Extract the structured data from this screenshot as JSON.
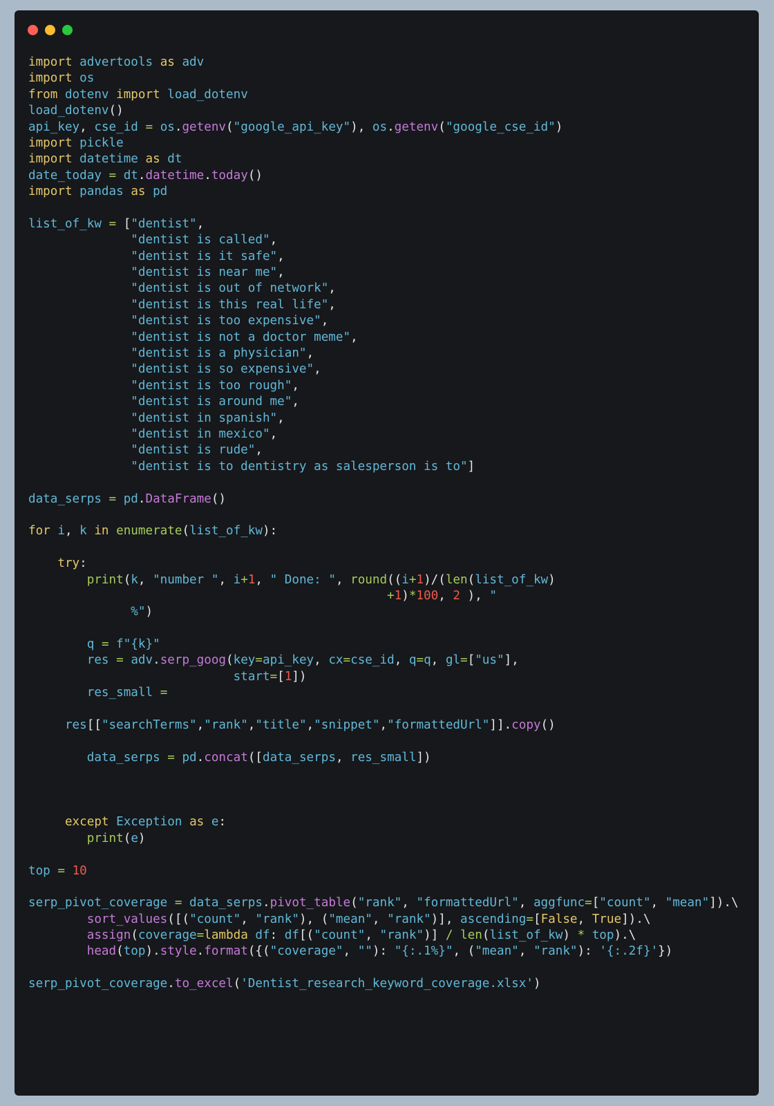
{
  "window": {
    "colors": {
      "background": "#16181b",
      "page_background": "#abbac8",
      "close_dot": "#fe5f57",
      "minimize_dot": "#febc2e",
      "maximize_dot": "#28c840"
    }
  },
  "syntax_colors": {
    "keyword": "#e6c86a",
    "identifier": "#62b8d8",
    "method": "#c67ad9",
    "builtin": "#a8cc5c",
    "string": "#62b8d8",
    "number": "#ef5a4a",
    "operator": "#a8cc5c",
    "punctuation": "#e6e6e6"
  },
  "code_lines": [
    [
      [
        "kw",
        "import"
      ],
      [
        "p",
        " "
      ],
      [
        "id",
        "advertools"
      ],
      [
        "p",
        " "
      ],
      [
        "kw",
        "as"
      ],
      [
        "p",
        " "
      ],
      [
        "id",
        "adv"
      ]
    ],
    [
      [
        "kw",
        "import"
      ],
      [
        "p",
        " "
      ],
      [
        "id",
        "os"
      ]
    ],
    [
      [
        "kw",
        "from"
      ],
      [
        "p",
        " "
      ],
      [
        "id",
        "dotenv"
      ],
      [
        "p",
        " "
      ],
      [
        "kw",
        "import"
      ],
      [
        "p",
        " "
      ],
      [
        "id",
        "load_dotenv"
      ]
    ],
    [
      [
        "id",
        "load_dotenv"
      ],
      [
        "p",
        "()"
      ]
    ],
    [
      [
        "id",
        "api_key"
      ],
      [
        "p",
        ", "
      ],
      [
        "id",
        "cse_id"
      ],
      [
        "p",
        " "
      ],
      [
        "op",
        "="
      ],
      [
        "p",
        " "
      ],
      [
        "id",
        "os"
      ],
      [
        "p",
        "."
      ],
      [
        "fn",
        "getenv"
      ],
      [
        "p",
        "("
      ],
      [
        "str",
        "\"google_api_key\""
      ],
      [
        "p",
        "), "
      ],
      [
        "id",
        "os"
      ],
      [
        "p",
        "."
      ],
      [
        "fn",
        "getenv"
      ],
      [
        "p",
        "("
      ],
      [
        "str",
        "\"google_cse_id\""
      ],
      [
        "p",
        ")"
      ]
    ],
    [
      [
        "kw",
        "import"
      ],
      [
        "p",
        " "
      ],
      [
        "id",
        "pickle"
      ]
    ],
    [
      [
        "kw",
        "import"
      ],
      [
        "p",
        " "
      ],
      [
        "id",
        "datetime"
      ],
      [
        "p",
        " "
      ],
      [
        "kw",
        "as"
      ],
      [
        "p",
        " "
      ],
      [
        "id",
        "dt"
      ]
    ],
    [
      [
        "id",
        "date_today"
      ],
      [
        "p",
        " "
      ],
      [
        "op",
        "="
      ],
      [
        "p",
        " "
      ],
      [
        "id",
        "dt"
      ],
      [
        "p",
        "."
      ],
      [
        "fn",
        "datetime"
      ],
      [
        "p",
        "."
      ],
      [
        "fn",
        "today"
      ],
      [
        "p",
        "()"
      ]
    ],
    [
      [
        "kw",
        "import"
      ],
      [
        "p",
        " "
      ],
      [
        "id",
        "pandas"
      ],
      [
        "p",
        " "
      ],
      [
        "kw",
        "as"
      ],
      [
        "p",
        " "
      ],
      [
        "id",
        "pd"
      ]
    ],
    [],
    [
      [
        "id",
        "list_of_kw"
      ],
      [
        "p",
        " "
      ],
      [
        "op",
        "="
      ],
      [
        "p",
        " ["
      ],
      [
        "str",
        "\"dentist\""
      ],
      [
        "p",
        ","
      ]
    ],
    [
      [
        "p",
        "              "
      ],
      [
        "str",
        "\"dentist is called\""
      ],
      [
        "p",
        ","
      ]
    ],
    [
      [
        "p",
        "              "
      ],
      [
        "str",
        "\"dentist is it safe\""
      ],
      [
        "p",
        ","
      ]
    ],
    [
      [
        "p",
        "              "
      ],
      [
        "str",
        "\"dentist is near me\""
      ],
      [
        "p",
        ","
      ]
    ],
    [
      [
        "p",
        "              "
      ],
      [
        "str",
        "\"dentist is out of network\""
      ],
      [
        "p",
        ","
      ]
    ],
    [
      [
        "p",
        "              "
      ],
      [
        "str",
        "\"dentist is this real life\""
      ],
      [
        "p",
        ","
      ]
    ],
    [
      [
        "p",
        "              "
      ],
      [
        "str",
        "\"dentist is too expensive\""
      ],
      [
        "p",
        ","
      ]
    ],
    [
      [
        "p",
        "              "
      ],
      [
        "str",
        "\"dentist is not a doctor meme\""
      ],
      [
        "p",
        ","
      ]
    ],
    [
      [
        "p",
        "              "
      ],
      [
        "str",
        "\"dentist is a physician\""
      ],
      [
        "p",
        ","
      ]
    ],
    [
      [
        "p",
        "              "
      ],
      [
        "str",
        "\"dentist is so expensive\""
      ],
      [
        "p",
        ","
      ]
    ],
    [
      [
        "p",
        "              "
      ],
      [
        "str",
        "\"dentist is too rough\""
      ],
      [
        "p",
        ","
      ]
    ],
    [
      [
        "p",
        "              "
      ],
      [
        "str",
        "\"dentist is around me\""
      ],
      [
        "p",
        ","
      ]
    ],
    [
      [
        "p",
        "              "
      ],
      [
        "str",
        "\"dentist in spanish\""
      ],
      [
        "p",
        ","
      ]
    ],
    [
      [
        "p",
        "              "
      ],
      [
        "str",
        "\"dentist in mexico\""
      ],
      [
        "p",
        ","
      ]
    ],
    [
      [
        "p",
        "              "
      ],
      [
        "str",
        "\"dentist is rude\""
      ],
      [
        "p",
        ","
      ]
    ],
    [
      [
        "p",
        "              "
      ],
      [
        "str",
        "\"dentist is to dentistry as salesperson is to\""
      ],
      [
        "p",
        "]"
      ]
    ],
    [],
    [
      [
        "id",
        "data_serps"
      ],
      [
        "p",
        " "
      ],
      [
        "op",
        "="
      ],
      [
        "p",
        " "
      ],
      [
        "id",
        "pd"
      ],
      [
        "p",
        "."
      ],
      [
        "fn",
        "DataFrame"
      ],
      [
        "p",
        "()"
      ]
    ],
    [],
    [
      [
        "kw",
        "for"
      ],
      [
        "p",
        " "
      ],
      [
        "id",
        "i"
      ],
      [
        "p",
        ", "
      ],
      [
        "id",
        "k"
      ],
      [
        "p",
        " "
      ],
      [
        "kw",
        "in"
      ],
      [
        "p",
        " "
      ],
      [
        "bi",
        "enumerate"
      ],
      [
        "p",
        "("
      ],
      [
        "id",
        "list_of_kw"
      ],
      [
        "p",
        "):"
      ]
    ],
    [],
    [
      [
        "p",
        "    "
      ],
      [
        "kw",
        "try"
      ],
      [
        "p",
        ":"
      ]
    ],
    [
      [
        "p",
        "        "
      ],
      [
        "bi",
        "print"
      ],
      [
        "p",
        "("
      ],
      [
        "id",
        "k"
      ],
      [
        "p",
        ", "
      ],
      [
        "str",
        "\"number \""
      ],
      [
        "p",
        ", "
      ],
      [
        "id",
        "i"
      ],
      [
        "op",
        "+"
      ],
      [
        "num",
        "1"
      ],
      [
        "p",
        ", "
      ],
      [
        "str",
        "\" Done: \""
      ],
      [
        "p",
        ", "
      ],
      [
        "bi",
        "round"
      ],
      [
        "p",
        "(("
      ],
      [
        "id",
        "i"
      ],
      [
        "op",
        "+"
      ],
      [
        "num",
        "1"
      ],
      [
        "p",
        ")/("
      ],
      [
        "bi",
        "len"
      ],
      [
        "p",
        "("
      ],
      [
        "id",
        "list_of_kw"
      ],
      [
        "p",
        ")"
      ]
    ],
    [
      [
        "p",
        "                                                 "
      ],
      [
        "op",
        "+"
      ],
      [
        "num",
        "1"
      ],
      [
        "p",
        ")"
      ],
      [
        "op",
        "*"
      ],
      [
        "num",
        "100"
      ],
      [
        "p",
        ", "
      ],
      [
        "num",
        "2"
      ],
      [
        "p",
        " ), "
      ],
      [
        "str",
        "\""
      ]
    ],
    [
      [
        "p",
        "              "
      ],
      [
        "str",
        "%\""
      ],
      [
        "p",
        ")"
      ]
    ],
    [],
    [
      [
        "p",
        "        "
      ],
      [
        "id",
        "q"
      ],
      [
        "p",
        " "
      ],
      [
        "op",
        "="
      ],
      [
        "p",
        " "
      ],
      [
        "id",
        "f"
      ],
      [
        "str",
        "\"{"
      ],
      [
        "id",
        "k"
      ],
      [
        "str",
        "}\""
      ]
    ],
    [
      [
        "p",
        "        "
      ],
      [
        "id",
        "res"
      ],
      [
        "p",
        " "
      ],
      [
        "op",
        "="
      ],
      [
        "p",
        " "
      ],
      [
        "id",
        "adv"
      ],
      [
        "p",
        "."
      ],
      [
        "fn",
        "serp_goog"
      ],
      [
        "p",
        "("
      ],
      [
        "id",
        "key"
      ],
      [
        "op",
        "="
      ],
      [
        "id",
        "api_key"
      ],
      [
        "p",
        ", "
      ],
      [
        "id",
        "cx"
      ],
      [
        "op",
        "="
      ],
      [
        "id",
        "cse_id"
      ],
      [
        "p",
        ", "
      ],
      [
        "id",
        "q"
      ],
      [
        "op",
        "="
      ],
      [
        "id",
        "q"
      ],
      [
        "p",
        ", "
      ],
      [
        "id",
        "gl"
      ],
      [
        "op",
        "="
      ],
      [
        "p",
        "["
      ],
      [
        "str",
        "\"us\""
      ],
      [
        "p",
        "],"
      ]
    ],
    [
      [
        "p",
        "                            "
      ],
      [
        "id",
        "start"
      ],
      [
        "op",
        "="
      ],
      [
        "p",
        "["
      ],
      [
        "num",
        "1"
      ],
      [
        "p",
        "])"
      ]
    ],
    [
      [
        "p",
        "        "
      ],
      [
        "id",
        "res_small"
      ],
      [
        "p",
        " "
      ],
      [
        "op",
        "="
      ]
    ],
    [],
    [
      [
        "p",
        "     "
      ],
      [
        "id",
        "res"
      ],
      [
        "p",
        "[["
      ],
      [
        "str",
        "\"searchTerms\""
      ],
      [
        "p",
        ","
      ],
      [
        "str",
        "\"rank\""
      ],
      [
        "p",
        ","
      ],
      [
        "str",
        "\"title\""
      ],
      [
        "p",
        ","
      ],
      [
        "str",
        "\"snippet\""
      ],
      [
        "p",
        ","
      ],
      [
        "str",
        "\"formattedUrl\""
      ],
      [
        "p",
        "]]."
      ],
      [
        "fn",
        "copy"
      ],
      [
        "p",
        "()"
      ]
    ],
    [],
    [
      [
        "p",
        "        "
      ],
      [
        "id",
        "data_serps"
      ],
      [
        "p",
        " "
      ],
      [
        "op",
        "="
      ],
      [
        "p",
        " "
      ],
      [
        "id",
        "pd"
      ],
      [
        "p",
        "."
      ],
      [
        "fn",
        "concat"
      ],
      [
        "p",
        "(["
      ],
      [
        "id",
        "data_serps"
      ],
      [
        "p",
        ", "
      ],
      [
        "id",
        "res_small"
      ],
      [
        "p",
        "])"
      ]
    ],
    [],
    [],
    [],
    [
      [
        "p",
        "     "
      ],
      [
        "kw",
        "except"
      ],
      [
        "p",
        " "
      ],
      [
        "id",
        "Exception"
      ],
      [
        "p",
        " "
      ],
      [
        "kw",
        "as"
      ],
      [
        "p",
        " "
      ],
      [
        "id",
        "e"
      ],
      [
        "p",
        ":"
      ]
    ],
    [
      [
        "p",
        "        "
      ],
      [
        "bi",
        "print"
      ],
      [
        "p",
        "("
      ],
      [
        "id",
        "e"
      ],
      [
        "p",
        ")"
      ]
    ],
    [],
    [
      [
        "id",
        "top"
      ],
      [
        "p",
        " "
      ],
      [
        "op",
        "="
      ],
      [
        "p",
        " "
      ],
      [
        "num",
        "10"
      ]
    ],
    [],
    [
      [
        "id",
        "serp_pivot_coverage"
      ],
      [
        "p",
        " "
      ],
      [
        "op",
        "="
      ],
      [
        "p",
        " "
      ],
      [
        "id",
        "data_serps"
      ],
      [
        "p",
        "."
      ],
      [
        "fn",
        "pivot_table"
      ],
      [
        "p",
        "("
      ],
      [
        "str",
        "\"rank\""
      ],
      [
        "p",
        ", "
      ],
      [
        "str",
        "\"formattedUrl\""
      ],
      [
        "p",
        ", "
      ],
      [
        "id",
        "aggfunc"
      ],
      [
        "op",
        "="
      ],
      [
        "p",
        "["
      ],
      [
        "str",
        "\"count\""
      ],
      [
        "p",
        ", "
      ],
      [
        "str",
        "\"mean\""
      ],
      [
        "p",
        "]).\\"
      ]
    ],
    [
      [
        "p",
        "        "
      ],
      [
        "fn",
        "sort_values"
      ],
      [
        "p",
        "([("
      ],
      [
        "str",
        "\"count\""
      ],
      [
        "p",
        ", "
      ],
      [
        "str",
        "\"rank\""
      ],
      [
        "p",
        "), ("
      ],
      [
        "str",
        "\"mean\""
      ],
      [
        "p",
        ", "
      ],
      [
        "str",
        "\"rank\""
      ],
      [
        "p",
        ")], "
      ],
      [
        "id",
        "ascending"
      ],
      [
        "op",
        "="
      ],
      [
        "p",
        "["
      ],
      [
        "bool",
        "False"
      ],
      [
        "p",
        ", "
      ],
      [
        "bool",
        "True"
      ],
      [
        "p",
        "]).\\"
      ]
    ],
    [
      [
        "p",
        "        "
      ],
      [
        "fn",
        "assign"
      ],
      [
        "p",
        "("
      ],
      [
        "id",
        "coverage"
      ],
      [
        "op",
        "="
      ],
      [
        "kw",
        "lambda"
      ],
      [
        "p",
        " "
      ],
      [
        "id",
        "df"
      ],
      [
        "p",
        ": "
      ],
      [
        "id",
        "df"
      ],
      [
        "p",
        "[("
      ],
      [
        "str",
        "\"count\""
      ],
      [
        "p",
        ", "
      ],
      [
        "str",
        "\"rank\""
      ],
      [
        "p",
        ")] "
      ],
      [
        "op",
        "/"
      ],
      [
        "p",
        " "
      ],
      [
        "bi",
        "len"
      ],
      [
        "p",
        "("
      ],
      [
        "id",
        "list_of_kw"
      ],
      [
        "p",
        ") "
      ],
      [
        "op",
        "*"
      ],
      [
        "p",
        " "
      ],
      [
        "id",
        "top"
      ],
      [
        "p",
        ").\\"
      ]
    ],
    [
      [
        "p",
        "        "
      ],
      [
        "fn",
        "head"
      ],
      [
        "p",
        "("
      ],
      [
        "id",
        "top"
      ],
      [
        "p",
        ")."
      ],
      [
        "fn",
        "style"
      ],
      [
        "p",
        "."
      ],
      [
        "fn",
        "format"
      ],
      [
        "p",
        "({("
      ],
      [
        "str",
        "\"coverage\""
      ],
      [
        "p",
        ", "
      ],
      [
        "str",
        "\"\""
      ],
      [
        "p",
        "): "
      ],
      [
        "str",
        "\"{:.1%}\""
      ],
      [
        "p",
        ", ("
      ],
      [
        "str",
        "\"mean\""
      ],
      [
        "p",
        ", "
      ],
      [
        "str",
        "\"rank\""
      ],
      [
        "p",
        "): "
      ],
      [
        "str",
        "'{:.2f}'"
      ],
      [
        "p",
        "})"
      ]
    ],
    [],
    [
      [
        "id",
        "serp_pivot_coverage"
      ],
      [
        "p",
        "."
      ],
      [
        "fn",
        "to_excel"
      ],
      [
        "p",
        "("
      ],
      [
        "str",
        "'Dentist_research_keyword_coverage.xlsx'"
      ],
      [
        "p",
        ")"
      ]
    ]
  ]
}
